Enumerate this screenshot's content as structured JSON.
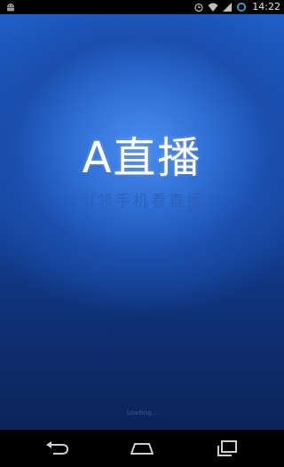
{
  "status_bar": {
    "left_icon": "android-robot-icon",
    "icons": [
      "alarm-icon",
      "wifi-icon",
      "signal-icon",
      "sync-icon"
    ],
    "time": "14:22"
  },
  "splash": {
    "title": "A直播",
    "slogan": "引领手机看直播",
    "footer": "Loading..."
  },
  "nav_bar": {
    "buttons": [
      "back-icon",
      "home-icon",
      "recents-icon"
    ]
  },
  "colors": {
    "background_top": "#1f5fc8",
    "background_glow": "#4a8ef0",
    "background_bottom": "#0b245a",
    "title": "#ffffff",
    "slogan": "#2e5fb3"
  }
}
